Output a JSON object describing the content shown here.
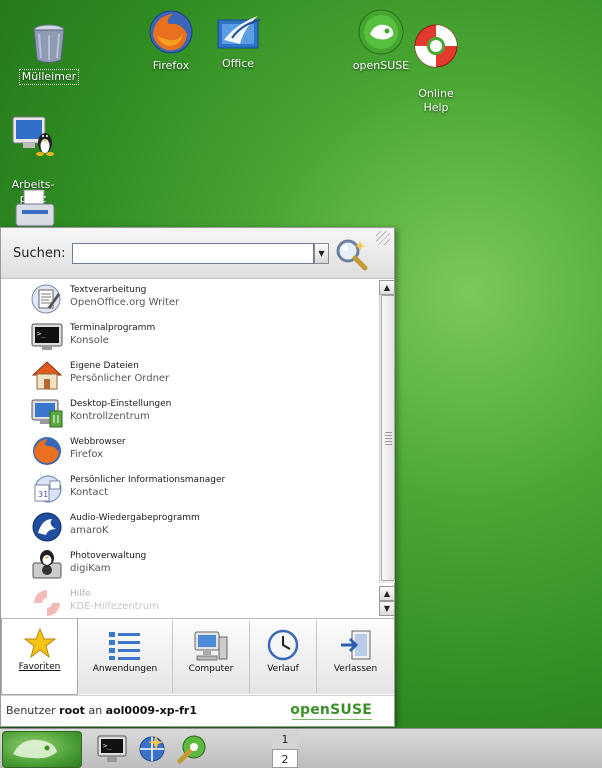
{
  "desktop": {
    "icons": [
      {
        "label": "Mülleimer",
        "icon": "trash-icon"
      },
      {
        "label": "Firefox",
        "icon": "firefox-icon"
      },
      {
        "label": "Office",
        "icon": "office-icon"
      },
      {
        "label": "openSUSE",
        "icon": "opensuse-icon"
      },
      {
        "label": "Online\nHelp",
        "icon": "lifebuoy-icon"
      },
      {
        "label": "Arbeits-\nplatz",
        "icon": "workplace-icon"
      },
      {
        "label": "",
        "icon": "printer-icon"
      }
    ]
  },
  "menu": {
    "search": {
      "label": "Suchen:",
      "value": ""
    },
    "favorites": [
      {
        "title": "Textverarbeitung",
        "subtitle": "OpenOffice.org Writer",
        "icon": "writer-icon"
      },
      {
        "title": "Terminalprogramm",
        "subtitle": "Konsole",
        "icon": "terminal-icon"
      },
      {
        "title": "Eigene Dateien",
        "subtitle": "Persönlicher Ordner",
        "icon": "home-icon"
      },
      {
        "title": "Desktop-Einstellungen",
        "subtitle": "Kontrollzentrum",
        "icon": "control-center-icon"
      },
      {
        "title": "Webbrowser",
        "subtitle": "Firefox",
        "icon": "firefox-icon"
      },
      {
        "title": "Persönlicher Informationsmanager",
        "subtitle": "Kontact",
        "icon": "kontact-icon"
      },
      {
        "title": "Audio-Wiedergabeprogramm",
        "subtitle": "amaroK",
        "icon": "amarok-icon"
      },
      {
        "title": "Photoverwaltung",
        "subtitle": "digiKam",
        "icon": "digikam-icon"
      },
      {
        "title": "Hilfe",
        "subtitle": "KDE-Hilfezentrum",
        "icon": "help-icon"
      }
    ],
    "tabs": [
      {
        "label": "Favoriten",
        "icon": "star-icon",
        "active": true
      },
      {
        "label": "Anwendungen",
        "icon": "list-icon",
        "active": false
      },
      {
        "label": "Computer",
        "icon": "computer-icon",
        "active": false
      },
      {
        "label": "Verlauf",
        "icon": "clock-icon",
        "active": false
      },
      {
        "label": "Verlassen",
        "icon": "exit-icon",
        "active": false
      }
    ],
    "status": {
      "prefix": "Benutzer",
      "user": "root",
      "middle": "an",
      "host": "aol0009-xp-fr1",
      "brand": "openSUSE"
    }
  },
  "taskbar": {
    "desktops": [
      "1",
      "2"
    ]
  },
  "colors": {
    "brand_green": "#3d8f2a",
    "desktop_green": "#4aa734"
  }
}
